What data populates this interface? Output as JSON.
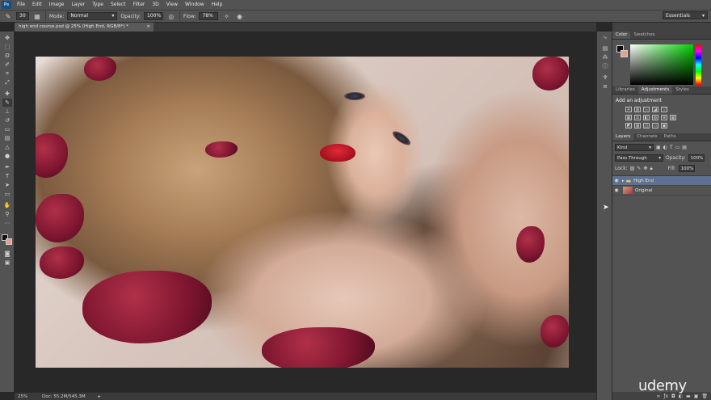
{
  "menu": [
    "File",
    "Edit",
    "Image",
    "Layer",
    "Type",
    "Select",
    "Filter",
    "3D",
    "View",
    "Window",
    "Help"
  ],
  "app_logo": "Ps",
  "options": {
    "brush_size": "30",
    "mode_label": "Mode:",
    "mode_value": "Normal",
    "opacity_label": "Opacity:",
    "opacity_value": "100%",
    "flow_label": "Flow:",
    "flow_value": "78%"
  },
  "workspace": "Essentials",
  "document_tab": {
    "title": "high end course.psd @ 25% (High End, RGB/8*) *",
    "close": "×"
  },
  "status": {
    "zoom": "25%",
    "doc": "Doc: 55.2M/545.3M"
  },
  "panels": {
    "color_tabs": [
      "Color",
      "Swatches"
    ],
    "fg_color": "#0b0b0b",
    "bg_color": "#e2a28e",
    "adjust_tabs": [
      "Libraries",
      "Adjustments",
      "Styles"
    ],
    "adjust_title": "Add an adjustment",
    "layers_tabs": [
      "Layers",
      "Channels",
      "Paths"
    ],
    "kind": "Kind",
    "blend": "Pass Through",
    "opacity_label": "Opacity:",
    "opacity_value": "100%",
    "lock_label": "Lock:",
    "fill_label": "Fill:",
    "fill_value": "100%",
    "layers": [
      {
        "name": "High End",
        "type": "group",
        "selected": true
      },
      {
        "name": "Original",
        "type": "image",
        "selected": false
      }
    ]
  },
  "watermark": "udemy"
}
